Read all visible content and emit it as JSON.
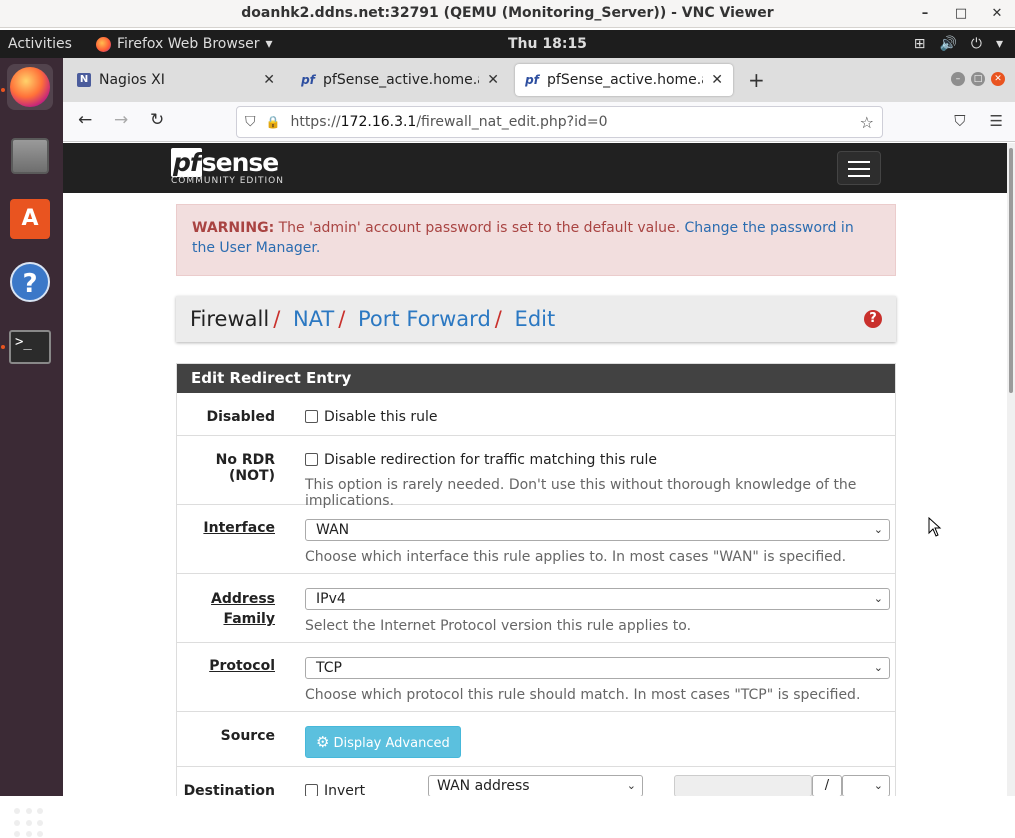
{
  "vnc": {
    "title": "doanhk2.ddns.net:32791 (QEMU (Monitoring_Server)) - VNC Viewer",
    "min": "–",
    "max": "□",
    "close": "✕"
  },
  "gnome": {
    "activities": "Activities",
    "app_name": "Firefox Web Browser",
    "app_arrow": "▾",
    "clock": "Thu 18:15",
    "tray_network": "⊞",
    "tray_volume": "🔊",
    "tray_power": "⏻",
    "tray_arrow": "▾"
  },
  "tabs": [
    {
      "label": "Nagios XI",
      "favicon": "N",
      "close": "✕"
    },
    {
      "label": "pfSense_active.home.arpa",
      "favicon": "pf",
      "close": "✕"
    },
    {
      "label": "pfSense_active.home.arpa",
      "favicon": "pf",
      "close": "✕"
    }
  ],
  "browser": {
    "new_tab": "+",
    "back": "←",
    "forward": "→",
    "reload": "↻",
    "url_prefix": "https://",
    "url_host": "172.16.3.1",
    "url_path": "/firewall_nat_edit.php?id=0",
    "star": "☆",
    "shield": "⛉",
    "lock": "🔒",
    "pocket": "⛉",
    "menu": "☰"
  },
  "pfsense": {
    "logo_main": "sense",
    "logo_pf": "pf",
    "logo_sub": "COMMUNITY EDITION",
    "warning_label": "WARNING:",
    "warning_text": " The 'admin' account password is set to the default value. ",
    "warning_link": "Change the password in the User Manager.",
    "breadcrumb": {
      "root": "Firewall",
      "nat": "NAT",
      "port_forward": "Port Forward",
      "edit": "Edit",
      "sep": "/"
    },
    "help_icon": "?",
    "panel_title": "Edit Redirect Entry",
    "rows": {
      "disabled": {
        "label": "Disabled",
        "checkbox_label": "Disable this rule"
      },
      "nordr": {
        "label": "No RDR (NOT)",
        "checkbox_label": "Disable redirection for traffic matching this rule",
        "help": "This option is rarely needed. Don't use this without thorough knowledge of the implications."
      },
      "interface": {
        "label": "Interface",
        "value": "WAN",
        "help": "Choose which interface this rule applies to. In most cases \"WAN\" is specified."
      },
      "address_family": {
        "label_1": "Address",
        "label_2": "Family",
        "value": "IPv4",
        "help": "Select the Internet Protocol version this rule applies to."
      },
      "protocol": {
        "label": "Protocol",
        "value": "TCP",
        "help": "Choose which protocol this rule should match. In most cases \"TCP\" is specified."
      },
      "source": {
        "label": "Source",
        "button": "Display Advanced",
        "gear": "⚙"
      },
      "destination": {
        "label": "Destination",
        "invert": "Invert",
        "address": "WAN address",
        "slash": "/"
      }
    }
  },
  "icons": {
    "chevron": "⌄"
  }
}
